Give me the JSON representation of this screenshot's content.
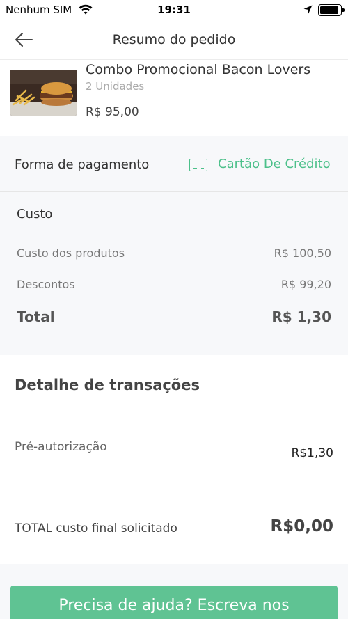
{
  "status_bar": {
    "carrier": "Nenhum SIM",
    "time": "19:31",
    "icons": [
      "wifi-icon",
      "location-arrow-icon",
      "battery-icon"
    ]
  },
  "nav": {
    "title": "Resumo do pedido",
    "back_icon": "arrow-left-icon"
  },
  "product": {
    "name": "Combo Promocional Bacon Lovers",
    "quantity": "2 Unidades",
    "price": "R$ 95,00"
  },
  "payment": {
    "label": "Forma de pagamento",
    "method": "Cartão De Crédito",
    "icon": "credit-card-icon"
  },
  "cost": {
    "title": "Custo",
    "rows": [
      {
        "label": "Custo dos produtos",
        "value": "R$ 100,50"
      },
      {
        "label": "Descontos",
        "value": "R$ 99,20"
      }
    ],
    "total_label": "Total",
    "total_value": "R$ 1,30"
  },
  "transactions": {
    "title": "Detalhe de transações",
    "pre_auth_label": "Pré-autorização",
    "pre_auth_value": "R$1,30",
    "final_label": "TOTAL custo final solicitado",
    "final_value": "R$0,00"
  },
  "help_button": {
    "label": "Precisa de ajuda? Escreva nos"
  },
  "colors": {
    "accent": "#4cc08a",
    "button": "#5fc393",
    "section_bg": "#f7f8fa"
  }
}
